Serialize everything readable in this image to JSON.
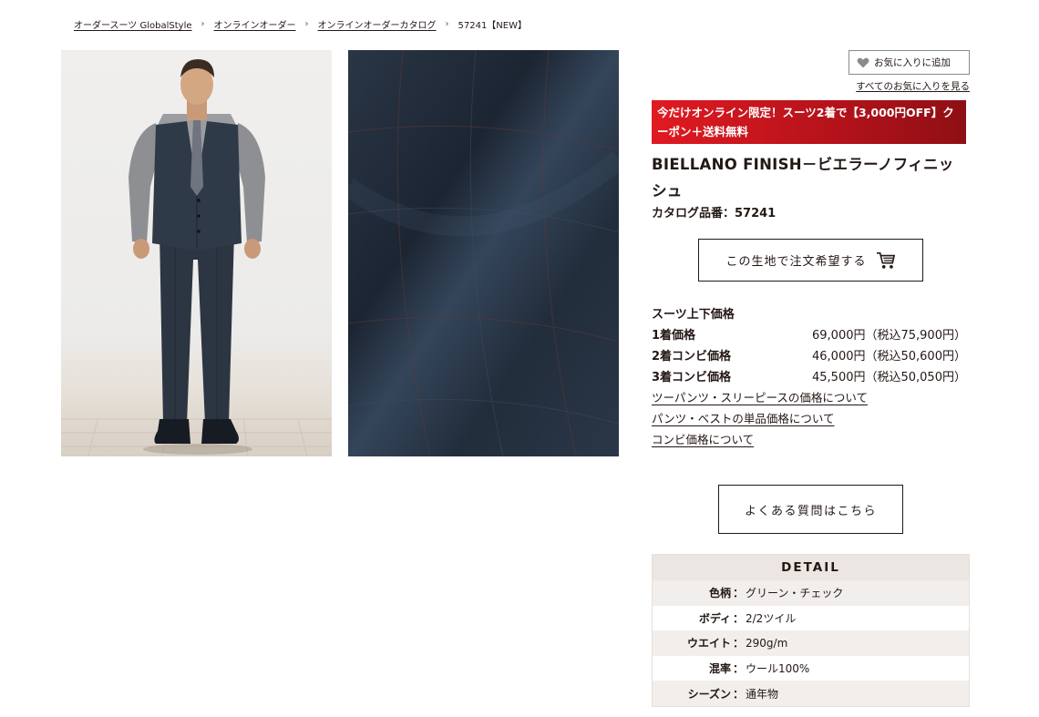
{
  "breadcrumb": {
    "items": [
      "オーダースーツ GlobalStyle",
      "オンラインオーダー",
      "オンラインオーダーカタログ"
    ],
    "separator": "›",
    "current": "57241【NEW】"
  },
  "favorites": {
    "add_label": "お気に入りに追加",
    "view_all_label": "すべてのお気に入りを見る"
  },
  "promo": {
    "text": "今だけオンライン限定！スーツ2着で【3,000円OFF】クーポン＋送料無料"
  },
  "product": {
    "title": "BIELLANO FINISH－ビエラーノフィニッシュ",
    "catalog_number": "カタログ品番：57241",
    "order_button_label": "この生地で注文希望する"
  },
  "pricing": {
    "heading": "スーツ上下価格",
    "rows": [
      {
        "label": "1着価格",
        "value": "69,000円（税込75,900円）"
      },
      {
        "label": "2着コンビ価格",
        "value": "46,000円（税込50,600円）"
      },
      {
        "label": "3着コンビ価格",
        "value": "45,500円（税込50,050円）"
      }
    ],
    "links": [
      "ツーパンツ・スリーピースの価格について",
      "パンツ・ベストの単品価格について",
      "コンビ価格について"
    ]
  },
  "faq": {
    "label": "よくある質問はこちら"
  },
  "detail": {
    "heading": "DETAIL",
    "separator": "：",
    "rows": [
      {
        "key": "色柄",
        "value": "グリーン・チェック"
      },
      {
        "key": "ボディ",
        "value": "2/2ツイル"
      },
      {
        "key": "ウエイト",
        "value": "290g/m"
      },
      {
        "key": "混率",
        "value": "ウール100%"
      },
      {
        "key": "シーズン",
        "value": "通年物"
      }
    ]
  },
  "colors": {
    "text": "#231815",
    "promo_start": "#e01a22",
    "promo_end": "#8e0f14",
    "fabric": "#253140",
    "detail_header": "#ebe6e1"
  },
  "icons": {
    "favorite": "heart-icon",
    "order": "cart-icon"
  }
}
